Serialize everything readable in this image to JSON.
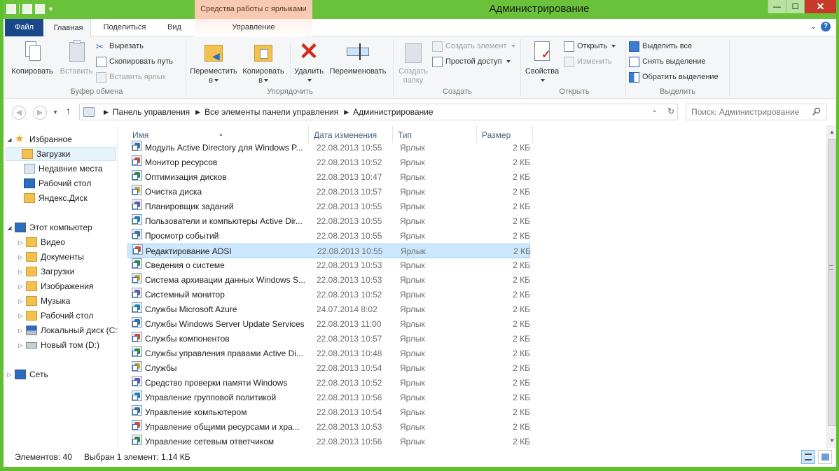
{
  "window": {
    "title": "Администрирование",
    "context_tab_group": "Средства работы с ярлыками",
    "minimize": "—",
    "maximize": "☐",
    "close": "✕"
  },
  "tabs": {
    "file": "Файл",
    "home": "Главная",
    "share": "Поделиться",
    "view": "Вид",
    "manage": "Управление"
  },
  "ribbon": {
    "clipboard": {
      "copy": "Копировать",
      "paste": "Вставить",
      "cut": "Вырезать",
      "copy_path": "Скопировать путь",
      "paste_shortcut": "Вставить ярлык",
      "label": "Буфер обмена"
    },
    "organize": {
      "move_l1": "Переместить",
      "move_l2": "в",
      "copy_l1": "Копировать",
      "copy_l2": "в",
      "delete_l1": "Удалить",
      "rename": "Переименовать",
      "label": "Упорядочить"
    },
    "new": {
      "new_folder_l1": "Создать",
      "new_folder_l2": "папку",
      "new_item": "Создать элемент",
      "easy_access": "Простой доступ",
      "label": "Создать"
    },
    "open": {
      "properties": "Свойства",
      "open": "Открыть",
      "edit": "Изменить",
      "label": "Открыть"
    },
    "select": {
      "select_all": "Выделить все",
      "select_none": "Снять выделение",
      "invert": "Обратить выделение",
      "label": "Выделить"
    }
  },
  "address": {
    "crumbs": [
      "Панель управления",
      "Все элементы панели управления",
      "Администрирование"
    ],
    "search_placeholder": "Поиск: Администрирование"
  },
  "navpane": {
    "favorites": "Избранное",
    "fav_items": [
      "Загрузки",
      "Недавние места",
      "Рабочий стол",
      "Яндекс.Диск"
    ],
    "computer": "Этот компьютер",
    "computer_items": [
      "Видео",
      "Документы",
      "Загрузки",
      "Изображения",
      "Музыка",
      "Рабочий стол",
      "Локальный диск (C:)",
      "Новый том (D:)"
    ],
    "network": "Сеть"
  },
  "columns": {
    "name": "Имя",
    "date": "Дата изменения",
    "type": "Тип",
    "size": "Размер"
  },
  "files": [
    {
      "name": "Модуль Active Directory для Windows P...",
      "date": "22.08.2013 10:55",
      "type": "Ярлык",
      "size": "2 КБ"
    },
    {
      "name": "Монитор ресурсов",
      "date": "22.08.2013 10:52",
      "type": "Ярлык",
      "size": "2 КБ"
    },
    {
      "name": "Оптимизация дисков",
      "date": "22.08.2013 10:47",
      "type": "Ярлык",
      "size": "2 КБ"
    },
    {
      "name": "Очистка диска",
      "date": "22.08.2013 10:57",
      "type": "Ярлык",
      "size": "2 КБ"
    },
    {
      "name": "Планировщик заданий",
      "date": "22.08.2013 10:55",
      "type": "Ярлык",
      "size": "2 КБ"
    },
    {
      "name": "Пользователи и компьютеры Active Dir...",
      "date": "22.08.2013 10:55",
      "type": "Ярлык",
      "size": "2 КБ"
    },
    {
      "name": "Просмотр событий",
      "date": "22.08.2013 10:55",
      "type": "Ярлык",
      "size": "2 КБ"
    },
    {
      "name": "Редактирование ADSI",
      "date": "22.08.2013 10:55",
      "type": "Ярлык",
      "size": "2 КБ"
    },
    {
      "name": "Сведения о системе",
      "date": "22.08.2013 10:53",
      "type": "Ярлык",
      "size": "2 КБ"
    },
    {
      "name": "Система архивации данных Windows S...",
      "date": "22.08.2013 10:53",
      "type": "Ярлык",
      "size": "2 КБ"
    },
    {
      "name": "Системный монитор",
      "date": "22.08.2013 10:52",
      "type": "Ярлык",
      "size": "2 КБ"
    },
    {
      "name": "Службы Microsoft Azure",
      "date": "24.07.2014 8:02",
      "type": "Ярлык",
      "size": "2 КБ"
    },
    {
      "name": "Службы Windows Server Update Services",
      "date": "22.08.2013 11:00",
      "type": "Ярлык",
      "size": "2 КБ"
    },
    {
      "name": "Службы компонентов",
      "date": "22.08.2013 10:57",
      "type": "Ярлык",
      "size": "2 КБ"
    },
    {
      "name": "Службы управления правами Active Di...",
      "date": "22.08.2013 10:48",
      "type": "Ярлык",
      "size": "2 КБ"
    },
    {
      "name": "Службы",
      "date": "22.08.2013 10:54",
      "type": "Ярлык",
      "size": "2 КБ"
    },
    {
      "name": "Средство проверки памяти Windows",
      "date": "22.08.2013 10:52",
      "type": "Ярлык",
      "size": "2 КБ"
    },
    {
      "name": "Управление групповой политикой",
      "date": "22.08.2013 10:56",
      "type": "Ярлык",
      "size": "2 КБ"
    },
    {
      "name": "Управление компьютером",
      "date": "22.08.2013 10:54",
      "type": "Ярлык",
      "size": "2 КБ"
    },
    {
      "name": "Управление общими ресурсами и хра...",
      "date": "22.08.2013 10:53",
      "type": "Ярлык",
      "size": "2 КБ"
    },
    {
      "name": "Управление сетевым ответчиком",
      "date": "22.08.2013 10:56",
      "type": "Ярлык",
      "size": "2 КБ"
    }
  ],
  "selected_file": "Редактирование ADSI",
  "status": {
    "count": "Элементов: 40",
    "selection": "Выбран 1 элемент: 1,14 КБ"
  },
  "colors": {
    "title_bar": "#69c23a",
    "context_tab": "#f8c9b3",
    "file_tab": "#19478a",
    "selection": "#cce8ff"
  }
}
